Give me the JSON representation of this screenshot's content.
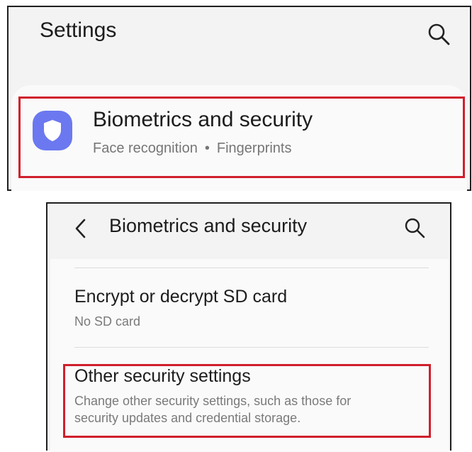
{
  "panel1": {
    "title": "Settings",
    "search_icon": "search-icon",
    "item": {
      "icon": "shield-icon",
      "icon_color": "#6b78f0",
      "title": "Biometrics and security",
      "subtitle_parts": [
        "Face recognition",
        "Fingerprints"
      ],
      "separator": "•"
    },
    "highlight_color": "#d01f2c"
  },
  "panel2": {
    "back_icon": "back-arrow-icon",
    "title": "Biometrics and security",
    "search_icon": "search-icon",
    "items": [
      {
        "title": "Encrypt or decrypt SD card",
        "subtitle": "No SD card"
      },
      {
        "title": "Other security settings",
        "subtitle_line1": "Change other security settings, such as those for",
        "subtitle_line2": "security updates and credential storage."
      }
    ],
    "highlight_color": "#d01f2c"
  }
}
